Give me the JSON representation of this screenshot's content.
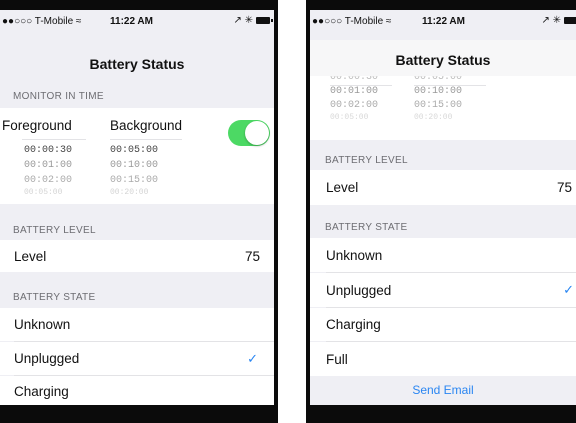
{
  "status_bar": {
    "carrier": "●●○○○ T-Mobile ≈",
    "time": "11:22 AM",
    "icons": "↗ ✳"
  },
  "nav": {
    "title": "Battery Status"
  },
  "monitor": {
    "header": "MONITOR IN TIME",
    "foreground_label": "Foreground",
    "background_label": "Background",
    "toggle_on": true,
    "foreground_times": [
      "00:00:30",
      "00:01:00",
      "00:02:00",
      "00:05:00"
    ],
    "background_times": [
      "00:05:00",
      "00:10:00",
      "00:15:00",
      "00:20:00"
    ],
    "partial_top_times": [
      "00:00:30",
      "00:05:00"
    ]
  },
  "battery_level": {
    "header": "BATTERY LEVEL",
    "label": "Level",
    "value": "75"
  },
  "battery_state": {
    "header": "BATTERY STATE",
    "options": [
      "Unknown",
      "Unplugged",
      "Charging",
      "Full"
    ],
    "selected": "Unplugged",
    "check": "✓"
  },
  "actions": {
    "send_email": "Send Email"
  },
  "colors": {
    "accent": "#2a86f2",
    "toggle_on": "#4cd964",
    "background": "#efeff4"
  }
}
